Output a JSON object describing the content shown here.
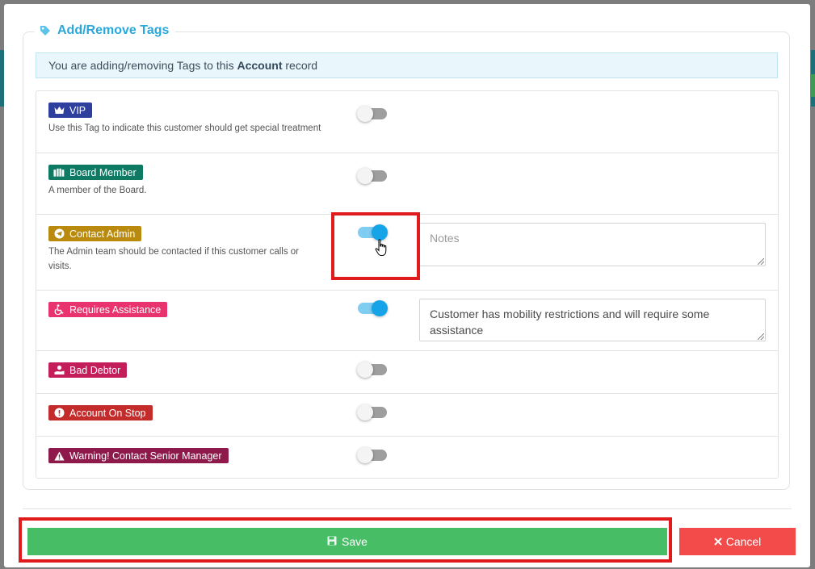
{
  "dialog": {
    "title": "Add/Remove Tags",
    "info_prefix": "You are adding/removing Tags to this ",
    "info_entity": "Account",
    "info_suffix": " record"
  },
  "tags": [
    {
      "label": "VIP",
      "icon": "crown-icon",
      "color": "#2e3f9e",
      "description": "Use this Tag to indicate this customer should get special treatment",
      "enabled": false,
      "notes": ""
    },
    {
      "label": "Board Member",
      "icon": "people-icon",
      "color": "#0f7a64",
      "description": "A member of the Board.",
      "enabled": false,
      "notes": ""
    },
    {
      "label": "Contact Admin",
      "icon": "telegram-icon",
      "color": "#b98a0d",
      "description": "The Admin team should be contacted if this customer calls or visits.",
      "enabled": true,
      "notes_placeholder": "Notes",
      "notes": ""
    },
    {
      "label": "Requires Assistance",
      "icon": "wheelchair-icon",
      "color": "#e8336e",
      "description": "",
      "enabled": true,
      "notes": "Customer has mobility restrictions and will require some assistance"
    },
    {
      "label": "Bad Debtor",
      "icon": "hand-coin-icon",
      "color": "#c41e5a",
      "description": "",
      "enabled": false,
      "notes": ""
    },
    {
      "label": "Account On Stop",
      "icon": "alert-circle-icon",
      "color": "#c42b2b",
      "description": "",
      "enabled": false,
      "notes": ""
    },
    {
      "label": "Warning! Contact Senior Manager",
      "icon": "warning-triangle-icon",
      "color": "#8e1a4c",
      "description": "",
      "enabled": false,
      "notes": ""
    }
  ],
  "footer": {
    "save_label": "Save",
    "cancel_label": "Cancel",
    "save_color": "#47be66",
    "cancel_color": "#f34a4a"
  },
  "colors": {
    "accent": "#29a8dc",
    "highlight": "#e11b1b"
  }
}
